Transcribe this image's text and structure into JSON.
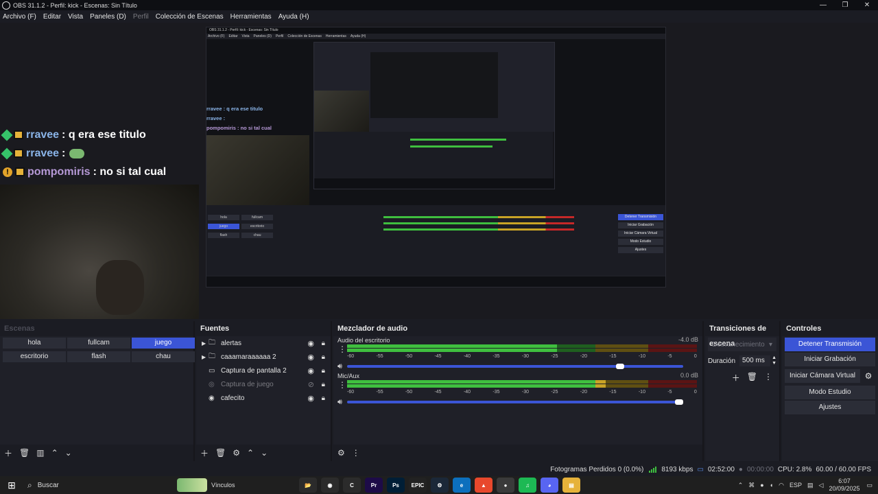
{
  "window": {
    "title": "OBS 31.1.2 - Perfil: kick - Escenas: Sin Título",
    "controls": [
      "—",
      "❐",
      "✕"
    ]
  },
  "menu": {
    "items": [
      "Archivo (F)",
      "Editar",
      "Vista",
      "Paneles (D)",
      "Perfil",
      "Colección de Escenas",
      "Herramientas",
      "Ayuda (H)"
    ]
  },
  "preview": {
    "chat": [
      {
        "user": "rravee",
        "message": ": q era ese titulo",
        "badge": "diamond"
      },
      {
        "user": "rravee",
        "message": ":",
        "badge": "diamond",
        "emote": true
      },
      {
        "user": "pompomiris",
        "message": ": no si tal cual",
        "badge": "warning"
      }
    ],
    "nested": {
      "title": "OBS 31.1.2 - Perfil: kick - Escenas: Sin Título",
      "menu": [
        "Archivo (F)",
        "Editar",
        "Vista",
        "Paneles (D)",
        "Perfil",
        "Colección de Escenas",
        "Herramientas",
        "Ayuda (H)"
      ],
      "chat": [
        "rravee : q era ese titulo",
        "rravee :",
        "pompomiris : no si tal cual"
      ],
      "scenes": [
        "hola",
        "fullcam",
        "juego",
        "escritorio",
        "flash",
        "chau"
      ],
      "controls": [
        "Detener Transmisión",
        "Iniciar Grabación",
        "Iniciar Cámara Virtual",
        "Modo Estudio",
        "Ajustes"
      ]
    }
  },
  "docks": {
    "scenes": {
      "title": "Escenas",
      "items": [
        {
          "label": "hola",
          "active": false
        },
        {
          "label": "fullcam",
          "active": false
        },
        {
          "label": "juego",
          "active": true
        },
        {
          "label": "escritorio",
          "active": false
        },
        {
          "label": "flash",
          "active": false
        },
        {
          "label": "chau",
          "active": false
        }
      ],
      "footer_icons": [
        "add-icon",
        "trash-icon",
        "filter-icon",
        "up-icon",
        "down-icon"
      ]
    },
    "sources": {
      "title": "Fuentes",
      "items": [
        {
          "label": "alertas",
          "type": "folder",
          "expandable": true,
          "visible": true
        },
        {
          "label": "caaamaraaaaaa 2",
          "type": "folder",
          "expandable": true,
          "visible": true
        },
        {
          "label": "Captura de pantalla 2",
          "type": "monitor",
          "expandable": false,
          "visible": true
        },
        {
          "label": "Captura de juego",
          "type": "gamepad",
          "expandable": false,
          "visible": false
        },
        {
          "label": "cafecito",
          "type": "globe",
          "expandable": false,
          "visible": true
        }
      ]
    },
    "mixer": {
      "title": "Mezclador de audio",
      "channels": [
        {
          "name": "Audio del escritorio",
          "db": "-4.0 dB",
          "level": 0.6,
          "volume": 0.82
        },
        {
          "name": "Mic/Aux",
          "db": "0.0 dB",
          "level": 0.74,
          "volume": 1.0
        }
      ],
      "scale": [
        "-60",
        "-55",
        "-50",
        "-45",
        "-40",
        "-35",
        "-30",
        "-25",
        "-20",
        "-15",
        "-10",
        "-5",
        "0"
      ]
    },
    "transitions": {
      "title": "Transiciones de escena",
      "selected": "Desvanecimiento",
      "duration_label": "Duración",
      "duration_value": "500 ms"
    },
    "controls": {
      "title": "Controles",
      "stream": "Detener Transmisión",
      "record": "Iniciar Grabación",
      "virtualcam": "Iniciar Cámara Virtual",
      "studio": "Modo Estudio",
      "settings": "Ajustes"
    }
  },
  "status": {
    "dropped": "Fotogramas Perdidos 0 (0.0%)",
    "bitrate": "8193 kbps",
    "stream_time": "02:52:00",
    "rec_time": "00:00:00",
    "cpu": "CPU: 2.8%",
    "fps": "60.00 / 60.00 FPS",
    "colors": {
      "signal": "#3fbf3f",
      "accent": "#3b55d6"
    }
  },
  "taskbar": {
    "search": "Buscar",
    "widget": "Vínculos",
    "apps": [
      {
        "name": "files",
        "label": "📂",
        "color": "#2b2b2b"
      },
      {
        "name": "obs",
        "label": "◉",
        "color": "#2b2b2b"
      },
      {
        "name": "c-app",
        "label": "C",
        "color": "#2b2b2b"
      },
      {
        "name": "premiere",
        "label": "Pr",
        "color": "#1d0b48"
      },
      {
        "name": "photoshop",
        "label": "Ps",
        "color": "#001e36"
      },
      {
        "name": "epic",
        "label": "EPIC",
        "color": "#222"
      },
      {
        "name": "steam",
        "label": "⚙",
        "color": "#1b2838"
      },
      {
        "name": "edge",
        "label": "e",
        "color": "#0c6fbd"
      },
      {
        "name": "brave",
        "label": "▲",
        "color": "#e8482c"
      },
      {
        "name": "chrome",
        "label": "●",
        "color": "#3a3a3a"
      },
      {
        "name": "spotify",
        "label": "♫",
        "color": "#1db954"
      },
      {
        "name": "discord",
        "label": "◕",
        "color": "#5865f2"
      },
      {
        "name": "explorer",
        "label": "▤",
        "color": "#e6b23a"
      }
    ],
    "lang": "ESP",
    "time": "6:07",
    "date": "20/09/2025"
  }
}
